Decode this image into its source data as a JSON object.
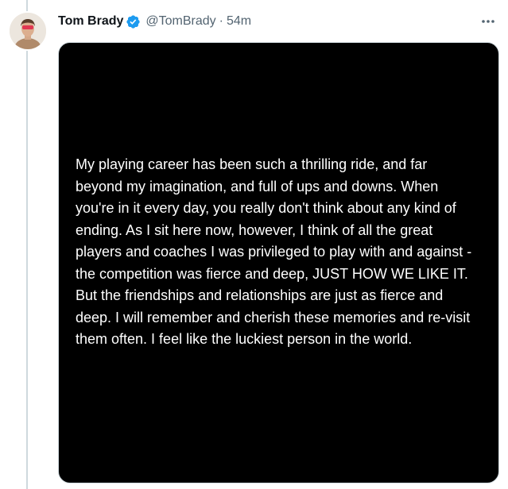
{
  "tweet": {
    "author_name": "Tom Brady",
    "handle": "@TomBrady",
    "separator": "·",
    "time_ago": "54m",
    "verified": true,
    "avatar_icon": "user-avatar",
    "more_icon": "more-horizontal-icon"
  },
  "media": {
    "background_color": "#000000",
    "text_color": "#ffffff",
    "lines": [
      "My playing career has been such a thrilling ride, and far",
      "beyond my imagination, and full of ups and downs.  When",
      "you're in it every day, you really don't think about any kind of",
      "ending.  As I sit here now, however, I think of all the great",
      "players and coaches I was privileged to play with and against -",
      "the competition was fierce and deep, JUST HOW WE LIKE IT.",
      "But the friendships and relationships are just as fierce and",
      "deep.  I will remember and cherish these memories and re-visit",
      "them often. I feel like the luckiest person in the world."
    ]
  },
  "colors": {
    "verified_badge": "#1d9bf0",
    "secondary_text": "#536471",
    "thread_line": "#cfd9de"
  }
}
